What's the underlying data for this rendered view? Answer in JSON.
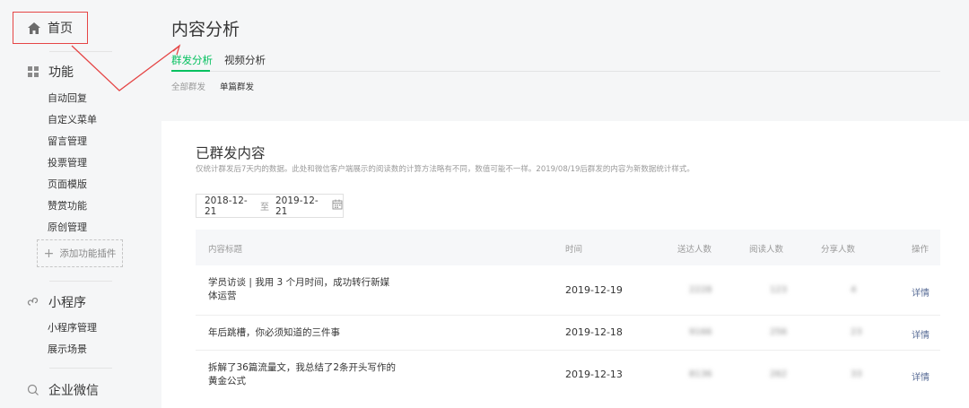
{
  "sidebar": {
    "home": "首页",
    "sections": [
      {
        "title": "功能",
        "icon": "grid-icon",
        "items": [
          "自动回复",
          "自定义菜单",
          "留言管理",
          "投票管理",
          "页面模版",
          "赞赏功能",
          "原创管理"
        ]
      },
      {
        "title": "小程序",
        "icon": "miniprogram-icon",
        "items": [
          "小程序管理",
          "展示场景"
        ]
      },
      {
        "title": "企业微信",
        "icon": "chat-icon",
        "items": []
      }
    ],
    "add_plugin": "添加功能插件"
  },
  "page": {
    "title": "内容分析",
    "tabs": [
      "群发分析",
      "视频分析"
    ],
    "subtabs": [
      "全部群发",
      "单篇群发"
    ]
  },
  "card": {
    "title": "已群发内容",
    "desc": "仅统计群发后7天内的数据。此处和微信客户端展示的阅读数的计算方法略有不同，数值可能不一样。2019/08/19后群发的内容为新数据统计样式。",
    "date_from": "2018-12-21",
    "date_sep": "至",
    "date_to": "2019-12-21"
  },
  "table": {
    "headers": [
      "内容标题",
      "时间",
      "送达人数",
      "阅读人数",
      "分享人数",
      "操作"
    ],
    "rows": [
      {
        "title": "学员访谈 | 我用 3 个月时间，成功转行新媒体运营",
        "time": "2019-12-19",
        "sent": "2228",
        "read": "123",
        "share": "4",
        "action": "详情"
      },
      {
        "title": "年后跳槽，你必须知道的三件事",
        "time": "2019-12-18",
        "sent": "9166",
        "read": "256",
        "share": "23",
        "action": "详情"
      },
      {
        "title": "拆解了36篇流量文，我总结了2条开头写作的黄金公式",
        "time": "2019-12-13",
        "sent": "8136",
        "read": "262",
        "share": "33",
        "action": "详情"
      }
    ]
  },
  "colors": {
    "accent": "#07c160",
    "annotation": "#e54545",
    "link": "#576b95"
  }
}
